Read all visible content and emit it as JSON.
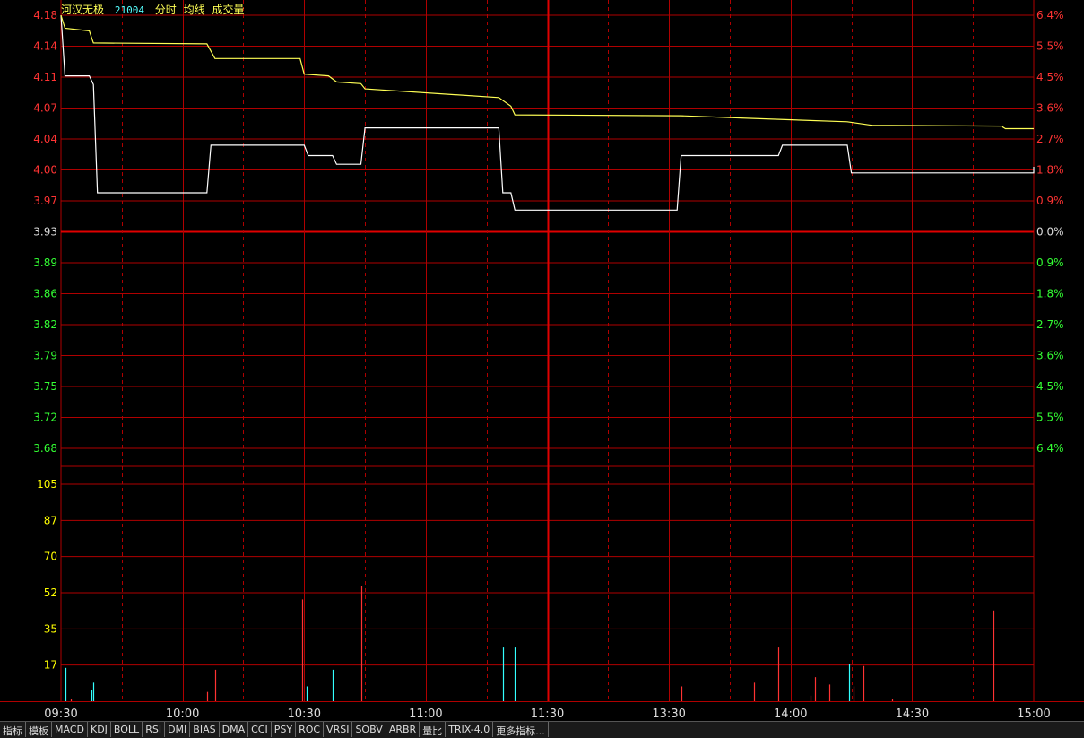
{
  "header": {
    "name": "河汉无极",
    "code": "21004",
    "tags": [
      "分时",
      "均线",
      "成交量"
    ]
  },
  "colors": {
    "grid": "#b00000",
    "grid_center": "#e00000",
    "up": "#ff3333",
    "down": "#33ff33",
    "neutral": "#dddddd",
    "volume_label": "#ffff00",
    "price_line": "#ffffff",
    "avg_line": "#ffff55",
    "vol_up": "#ff3333",
    "vol_down": "#33ffff"
  },
  "chart_data": [
    {
      "type": "line",
      "title": "",
      "y_left_ticks": [
        "4.18",
        "4.14",
        "4.11",
        "4.07",
        "4.04",
        "4.00",
        "3.97",
        "3.93",
        "3.89",
        "3.86",
        "3.82",
        "3.79",
        "3.75",
        "3.72",
        "3.68"
      ],
      "y_right_ticks": [
        "6.4%",
        "5.5%",
        "4.5%",
        "3.6%",
        "2.7%",
        "1.8%",
        "0.9%",
        "0.0%",
        "0.9%",
        "1.8%",
        "2.7%",
        "3.6%",
        "4.5%",
        "5.5%",
        "6.4%"
      ],
      "ylim": [
        3.68,
        4.18
      ],
      "x_ticks": [
        "09:30",
        "10:00",
        "10:30",
        "11:00",
        "11:30",
        "13:30",
        "14:00",
        "14:30",
        "15:00"
      ],
      "x_range_minutes": [
        0,
        240
      ],
      "series": [
        {
          "role": "price",
          "points": [
            [
              0,
              4.18
            ],
            [
              1,
              4.11
            ],
            [
              7,
              4.11
            ],
            [
              8,
              4.1
            ],
            [
              9,
              3.975
            ],
            [
              36,
              3.975
            ],
            [
              37,
              4.03
            ],
            [
              60,
              4.03
            ],
            [
              61,
              4.018
            ],
            [
              67,
              4.018
            ],
            [
              68,
              4.008
            ],
            [
              74,
              4.008
            ],
            [
              75,
              4.05
            ],
            [
              108,
              4.05
            ],
            [
              109,
              3.975
            ],
            [
              111,
              3.975
            ],
            [
              112,
              3.955
            ],
            [
              152,
              3.955
            ],
            [
              153,
              4.018
            ],
            [
              177,
              4.018
            ],
            [
              178,
              4.03
            ],
            [
              194,
              4.03
            ],
            [
              195,
              3.998
            ],
            [
              240,
              3.998
            ],
            [
              240,
              4.005
            ]
          ]
        },
        {
          "role": "average",
          "points": [
            [
              0,
              4.18
            ],
            [
              1,
              4.165
            ],
            [
              7,
              4.162
            ],
            [
              8,
              4.148
            ],
            [
              36,
              4.147
            ],
            [
              38,
              4.13
            ],
            [
              59,
              4.13
            ],
            [
              60,
              4.112
            ],
            [
              66,
              4.11
            ],
            [
              68,
              4.103
            ],
            [
              74,
              4.101
            ],
            [
              75,
              4.095
            ],
            [
              108,
              4.085
            ],
            [
              111,
              4.075
            ],
            [
              112,
              4.065
            ],
            [
              153,
              4.064
            ],
            [
              170,
              4.061
            ],
            [
              194,
              4.057
            ],
            [
              200,
              4.053
            ],
            [
              232,
              4.052
            ],
            [
              233,
              4.049
            ],
            [
              240,
              4.049
            ]
          ]
        }
      ]
    },
    {
      "type": "bar",
      "title": "",
      "y_ticks": [
        "105",
        "87",
        "70",
        "52",
        "35",
        "17"
      ],
      "ylim": [
        0,
        122
      ],
      "x_range_minutes": [
        0,
        240
      ],
      "bars": [
        {
          "t": 1,
          "v": 18,
          "dir": "down"
        },
        {
          "t": 2.5,
          "v": 1,
          "dir": "up"
        },
        {
          "t": 7.5,
          "v": 6,
          "dir": "down"
        },
        {
          "t": 8,
          "v": 10,
          "dir": "down"
        },
        {
          "t": 36,
          "v": 5,
          "dir": "up"
        },
        {
          "t": 38,
          "v": 17,
          "dir": "up"
        },
        {
          "t": 59.5,
          "v": 55,
          "dir": "up"
        },
        {
          "t": 60.5,
          "v": 8,
          "dir": "down"
        },
        {
          "t": 67,
          "v": 17,
          "dir": "down"
        },
        {
          "t": 74,
          "v": 62,
          "dir": "up"
        },
        {
          "t": 109,
          "v": 29,
          "dir": "down"
        },
        {
          "t": 112,
          "v": 29,
          "dir": "down"
        },
        {
          "t": 153,
          "v": 8,
          "dir": "up"
        },
        {
          "t": 171,
          "v": 10,
          "dir": "up"
        },
        {
          "t": 177,
          "v": 29,
          "dir": "up"
        },
        {
          "t": 185,
          "v": 3,
          "dir": "up"
        },
        {
          "t": 186,
          "v": 13,
          "dir": "up"
        },
        {
          "t": 189.5,
          "v": 9,
          "dir": "up"
        },
        {
          "t": 194.5,
          "v": 20,
          "dir": "down"
        },
        {
          "t": 195.5,
          "v": 8,
          "dir": "up"
        },
        {
          "t": 198,
          "v": 19,
          "dir": "up"
        },
        {
          "t": 205,
          "v": 1,
          "dir": "up"
        },
        {
          "t": 230,
          "v": 49,
          "dir": "up"
        }
      ]
    }
  ],
  "tabs": [
    "指标",
    "模板",
    "MACD",
    "KDJ",
    "BOLL",
    "RSI",
    "DMI",
    "BIAS",
    "DMA",
    "CCI",
    "PSY",
    "ROC",
    "VRSI",
    "SOBV",
    "ARBR",
    "量比",
    "TRIX-4.0",
    "更多指标..."
  ]
}
